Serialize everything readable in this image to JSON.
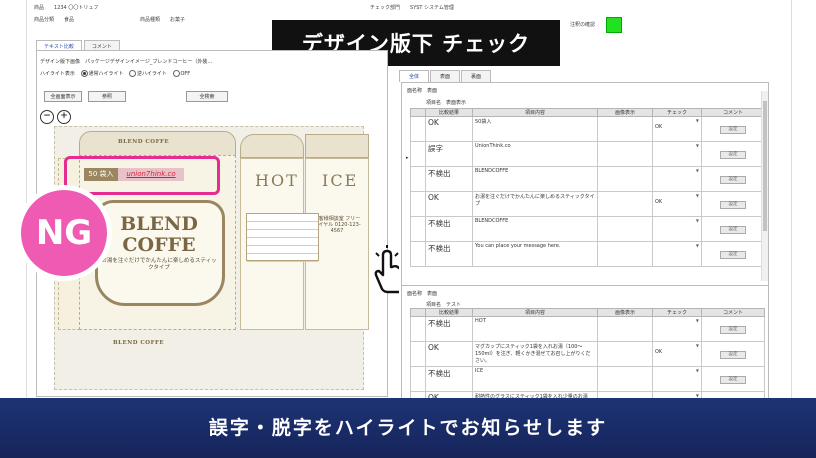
{
  "header": {
    "product_label": "商品",
    "product_value": "1234 〇〇トリュフ",
    "class_label": "商品分類",
    "class_value": "食品",
    "type_label": "商品種類",
    "type_value": "お菓子",
    "dept_label": "チェック部門",
    "dept_value": "SYST システム管理",
    "note_label": "注釈の確認"
  },
  "banner": {
    "title": "デザイン版下 チェック"
  },
  "left_tabs": [
    "テキスト比較",
    "コメント"
  ],
  "left": {
    "design_label": "デザイン版下画像",
    "design_value": "パッケージデザインイメージ_ブレンドコーヒー（外装...",
    "highlight_label": "ハイライト表示",
    "radio_normal": "通常ハイライト",
    "radio_reverse": "逆ハイライト",
    "radio_off": "OFF",
    "btn_full": "全画面表示",
    "btn_ref": "参照",
    "btn_all_search": "全検索"
  },
  "package": {
    "badge_qty": "50 袋入",
    "badge_url": "union7hink.co",
    "ng": "NG",
    "brand_line1": "BLEND",
    "brand_line2": "COFFE",
    "brand_sub": "お湯を注ぐだけでかんたんに楽しめるスティックタイプ",
    "ribbon": "BLEND COFFE",
    "hot": "HOT",
    "ice": "ICE",
    "ice_text": "お客様相談室 フリーダイヤル 0120-123-4567"
  },
  "right_tabs": [
    "全体",
    "表面",
    "裏面"
  ],
  "section1": {
    "face_label": "面名称",
    "face_value": "表面",
    "item_label": "項目名",
    "item_value": "表面表示",
    "columns": [
      "比較結果",
      "項目内容",
      "画像表示",
      "チェック",
      "コメント"
    ],
    "rows": [
      {
        "result": "OK",
        "content": "50袋入",
        "check": "OK",
        "btn": "設定"
      },
      {
        "result": "誤字",
        "content": "UnionThink.co",
        "check": "",
        "btn": "設定"
      },
      {
        "result": "不検出",
        "content": "BLENDCOFFE",
        "check": "",
        "btn": "設定"
      },
      {
        "result": "OK",
        "content": "お湯を注ぐだけでかんたんに楽しめるスティックタイプ",
        "check": "OK",
        "btn": "設定"
      },
      {
        "result": "不検出",
        "content": "BLENDCOFFE",
        "check": "",
        "btn": "設定"
      },
      {
        "result": "不検出",
        "content": "You can place your message here.",
        "check": "",
        "btn": "設定"
      }
    ]
  },
  "section2": {
    "face_label": "面名称",
    "face_value": "表面",
    "item_label": "項目名",
    "item_value": "テスト",
    "columns": [
      "比較結果",
      "項目内容",
      "画像表示",
      "チェック",
      "コメント"
    ],
    "rows": [
      {
        "result": "不検出",
        "content": "HOT",
        "check": "",
        "btn": "設定"
      },
      {
        "result": "OK",
        "content": "マグカップにスティック1袋を入れお湯（100〜150ml）を注ぎ、軽くかき混ぜてお召し上がりください。",
        "check": "OK",
        "btn": "設定"
      },
      {
        "result": "不検出",
        "content": "ICE",
        "check": "",
        "btn": "設定"
      },
      {
        "result": "OK",
        "content": "耐熱性のグラスにスティック1袋を入れ少量のお湯（30ml...",
        "check": "",
        "btn": "設定"
      }
    ]
  },
  "footer": {
    "caption": "誤字・脱字をハイライトでお知らせします"
  },
  "colors": {
    "ng_pink": "#ef5ab2",
    "highlight_pink": "#e62b91",
    "status_green": "#21e121",
    "footer_navy": "#1d3475"
  }
}
